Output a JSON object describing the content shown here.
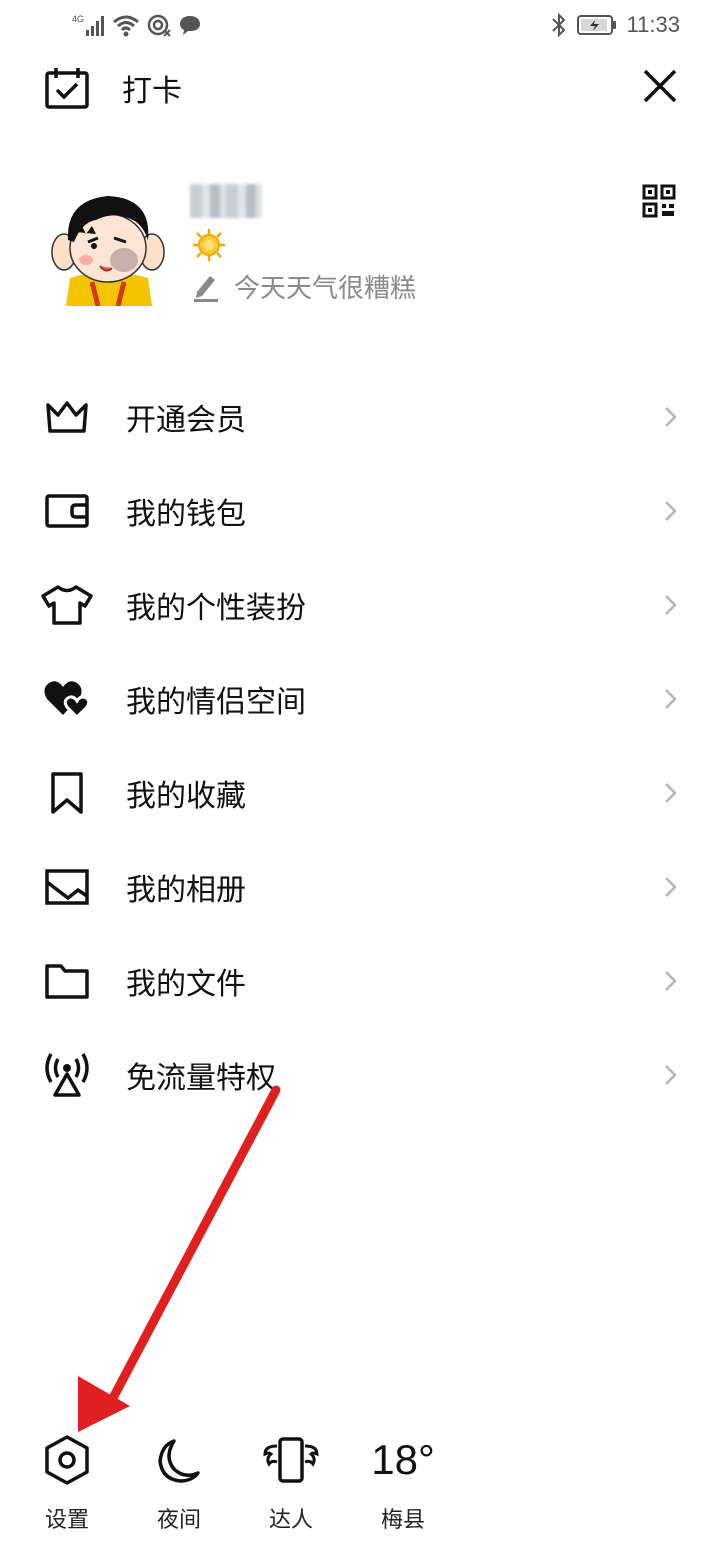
{
  "status_bar": {
    "network": "4G",
    "time": "11:33",
    "icons": [
      "signal-icon",
      "wifi-icon",
      "hotspot-icon",
      "message-icon",
      "bluetooth-icon",
      "battery-icon"
    ]
  },
  "header": {
    "checkin_label": "打卡"
  },
  "profile": {
    "signature": "今天天气很糟糕"
  },
  "menu": {
    "items": [
      {
        "label": "开通会员",
        "icon": "crown-icon"
      },
      {
        "label": "我的钱包",
        "icon": "wallet-icon"
      },
      {
        "label": "我的个性装扮",
        "icon": "tshirt-icon"
      },
      {
        "label": "我的情侣空间",
        "icon": "hearts-icon"
      },
      {
        "label": "我的收藏",
        "icon": "bookmark-icon"
      },
      {
        "label": "我的相册",
        "icon": "photo-icon"
      },
      {
        "label": "我的文件",
        "icon": "folder-icon"
      },
      {
        "label": "免流量特权",
        "icon": "signal-tower-icon"
      }
    ]
  },
  "footer": {
    "settings_label": "设置",
    "night_label": "夜间",
    "expert_label": "达人",
    "temperature": "18°",
    "city": "梅县"
  },
  "colors": {
    "annotation_arrow": "#e02020",
    "text_primary": "#111111",
    "text_secondary": "#8a8a8a",
    "chevron": "#b5b5b5"
  }
}
